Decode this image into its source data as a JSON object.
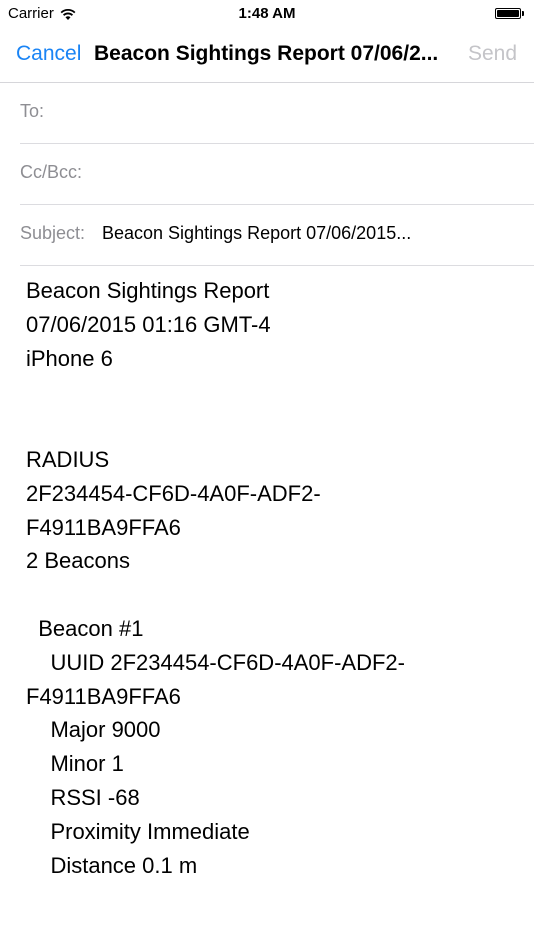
{
  "status_bar": {
    "carrier": "Carrier",
    "time": "1:48 AM",
    "battery_level": 1.0
  },
  "nav": {
    "cancel_label": "Cancel",
    "title": "Beacon Sightings Report 07/06/2...",
    "send_label": "Send",
    "accent_color": "#1a84f5",
    "disabled_color": "#c4c4c8"
  },
  "fields": {
    "to_label": "To:",
    "cc_label": "Cc/Bcc:",
    "subject_label": "Subject:",
    "subject_value": "Beacon Sightings Report 07/06/2015..."
  },
  "body_lines": [
    "Beacon Sightings Report",
    "07/06/2015 01:16 GMT-4",
    "iPhone 6",
    "",
    "",
    "RADIUS",
    "2F234454-CF6D-4A0F-ADF2-",
    "F4911BA9FFA6",
    "2 Beacons",
    "",
    "  Beacon #1",
    "    UUID 2F234454-CF6D-4A0F-ADF2-",
    "F4911BA9FFA6",
    "    Major 9000",
    "    Minor 1",
    "    RSSI -68",
    "    Proximity Immediate",
    "    Distance 0.1 m"
  ]
}
